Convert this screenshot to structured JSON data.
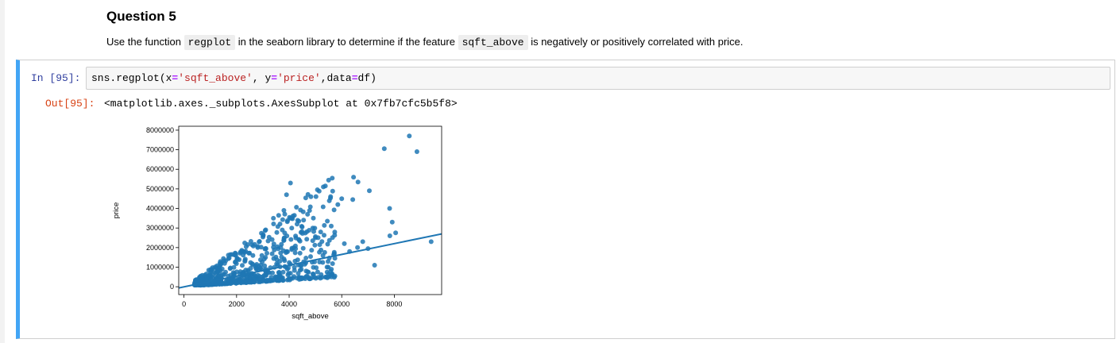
{
  "question": {
    "title": "Question 5",
    "text_before": "Use the function ",
    "code1": "regplot",
    "text_middle": " in the seaborn library to determine if the feature ",
    "code2": "sqft_above",
    "text_after": " is negatively or positively correlated with price."
  },
  "cell": {
    "in_prompt": "In [95]:",
    "code": {
      "p1": "sns.regplot(x",
      "eq1": "=",
      "s1": "'sqft_above'",
      "p2": ", y",
      "eq2": "=",
      "s2": "'price'",
      "p3": ",data",
      "eq3": "=",
      "p4": "df)"
    },
    "out_prompt": "Out[95]:",
    "output_text": "<matplotlib.axes._subplots.AxesSubplot at 0x7fb7cfc5b5f8>"
  },
  "chart_data": {
    "type": "scatter",
    "xlabel": "sqft_above",
    "ylabel": "price",
    "xticks": [
      0,
      2000,
      4000,
      6000,
      8000
    ],
    "yticks": [
      0,
      1000000,
      2000000,
      3000000,
      4000000,
      5000000,
      6000000,
      7000000,
      8000000
    ],
    "xtick_labels": [
      "0",
      "2000",
      "4000",
      "6000",
      "8000"
    ],
    "ytick_labels": [
      "0",
      "1000000",
      "2000000",
      "3000000",
      "4000000",
      "5000000",
      "6000000",
      "7000000",
      "8000000"
    ],
    "xlim": [
      -200,
      9800
    ],
    "ylim": [
      -400000,
      8200000
    ],
    "grid": false,
    "point_color": "#1f77b4",
    "line_color": "#1f77b4",
    "regression_line": {
      "x": [
        -200,
        9800
      ],
      "y": [
        -60000,
        2700000
      ]
    },
    "outliers": {
      "x": [
        8570,
        7620,
        8860,
        4050,
        5300,
        6450,
        6620,
        6000,
        5850,
        6420,
        3900,
        7050,
        7820,
        7250,
        7830,
        8050,
        9400,
        7920,
        7000,
        6600,
        6300,
        6100,
        5600,
        4700,
        4550,
        4200,
        5200,
        4900,
        5000,
        3600,
        3400,
        4300,
        4100,
        6800,
        3800
      ],
      "y": [
        7700000,
        7050000,
        6900000,
        5300000,
        5100000,
        5600000,
        5350000,
        4500000,
        4200000,
        4450000,
        4700000,
        4900000,
        4000000,
        1100000,
        2600000,
        2750000,
        2300000,
        3300000,
        1950000,
        2000000,
        1800000,
        2200000,
        3100000,
        3700000,
        3400000,
        3650000,
        2800000,
        3000000,
        2500000,
        3650000,
        3500000,
        3200000,
        3000000,
        2300000,
        3900000
      ]
    },
    "cloud": {
      "x_min": 400,
      "x_max": 5800,
      "y_min": 80000,
      "seed": 7,
      "count": 650
    }
  }
}
